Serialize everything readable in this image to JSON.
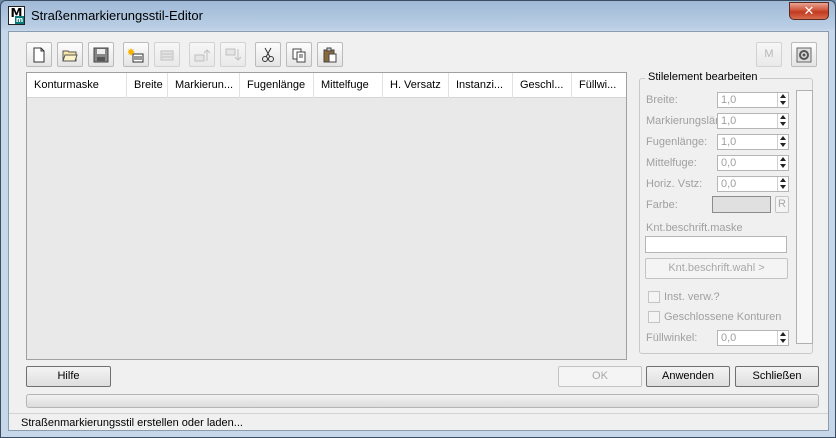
{
  "window": {
    "title": "Straßenmarkierungsstil-Editor",
    "close_label": "✕",
    "app_icon_letter": "M",
    "app_icon_sub": "m"
  },
  "toolbar": {
    "icons": [
      "new-file-icon",
      "open-folder-icon",
      "save-icon",
      "add-element-icon",
      "remove-element-icon",
      "move-up-icon",
      "move-down-icon",
      "cut-icon",
      "copy-icon",
      "paste-icon"
    ],
    "m_label": "M"
  },
  "table": {
    "columns": [
      "Konturmaske",
      "Breite",
      "Markierun...",
      "Fugenlänge",
      "Mittelfuge",
      "H. Versatz",
      "Instanzi...",
      "Geschl...",
      "Füllwi..."
    ],
    "rows": []
  },
  "panel": {
    "title": "Stilelement bearbeiten",
    "breite_label": "Breite:",
    "breite_value": "1,0",
    "markierungslaenge_label": "Markierungslänge:",
    "markierungslaenge_value": "1,0",
    "fugenlaenge_label": "Fugenlänge:",
    "fugenlaenge_value": "1,0",
    "mittelfuge_label": "Mittelfuge:",
    "mittelfuge_value": "0,0",
    "horiz_label": "Horiz. Vstz:",
    "horiz_value": "0,0",
    "farbe_label": "Farbe:",
    "farbe_reset_label": "R",
    "knt_maske_label": "Knt.beschrift.maske",
    "knt_maske_value": "",
    "knt_wahl_label": "Knt.beschrift.wahl >",
    "inst_label": "Inst. verw.?",
    "geschl_label": "Geschlossene Konturen",
    "fuellwinkel_label": "Füllwinkel:",
    "fuellwinkel_value": "0,0"
  },
  "buttons": {
    "help": "Hilfe",
    "ok": "OK",
    "apply": "Anwenden",
    "close": "Schließen"
  },
  "progress": {
    "value": 0
  },
  "status": {
    "text": "Straßenmarkierungsstil erstellen oder laden..."
  }
}
